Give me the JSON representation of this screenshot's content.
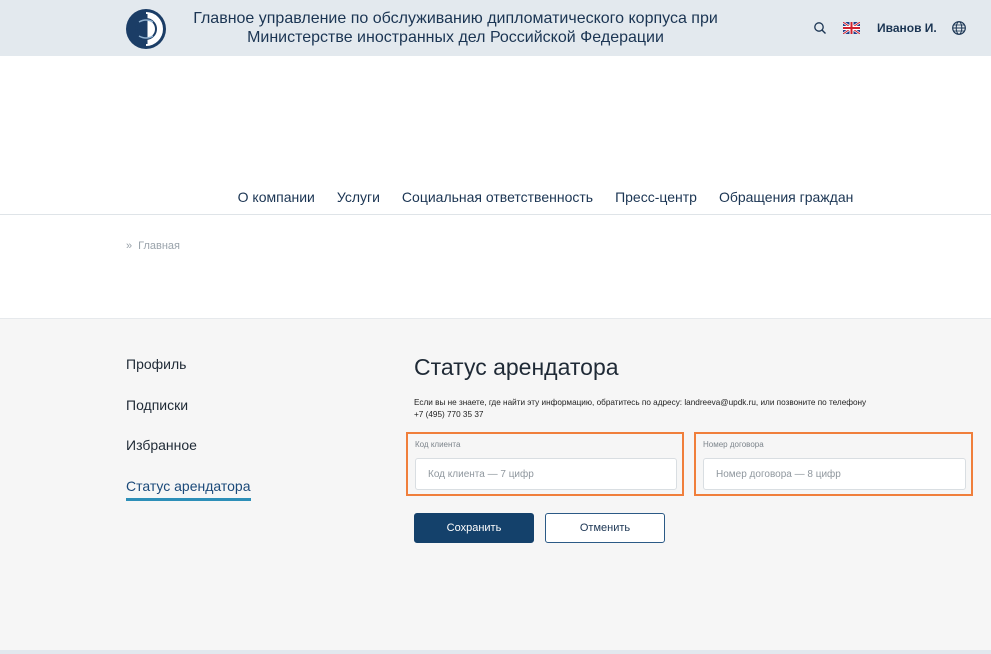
{
  "header": {
    "org_title": "Главное управление по обслуживанию дипломатического корпуса при Министерстве иностранных дел Российской Федерации",
    "user_name": "Иванов И.",
    "icons": [
      "logo-icon",
      "search-icon",
      "uk-flag-icon",
      "globe-icon"
    ]
  },
  "nav": {
    "items": [
      {
        "label": "О компании"
      },
      {
        "label": "Услуги"
      },
      {
        "label": "Социальная ответственность"
      },
      {
        "label": "Пресс-центр"
      },
      {
        "label": "Обращения граждан"
      }
    ]
  },
  "breadcrumb": {
    "separator": "»",
    "home": "Главная"
  },
  "sidebar": {
    "items": [
      {
        "label": "Профиль"
      },
      {
        "label": "Подписки"
      },
      {
        "label": "Избранное"
      },
      {
        "label": "Статус арендатора",
        "active": true
      }
    ]
  },
  "form": {
    "title": "Статус арендатора",
    "hint_line1": "Если вы не знаете, где найти эту информацию, обратитесь по адресу: landreeva@updk.ru, или позвоните по телефону",
    "hint_line2": "+7 (495) 770 35 37",
    "client_code": {
      "label": "Код клиента",
      "placeholder": "Код клиента — 7 цифр",
      "value": ""
    },
    "contract_number": {
      "label": "Номер договора",
      "placeholder": "Номер договора — 8 цифр",
      "value": ""
    },
    "save_label": "Сохранить",
    "cancel_label": "Отменить"
  },
  "colors": {
    "header_bg": "#e3e9ee",
    "brand_dark": "#14416b",
    "highlight_orange": "#f07f3c",
    "active_underline": "#2d8fb8",
    "content_bg": "#f6f6f6"
  }
}
